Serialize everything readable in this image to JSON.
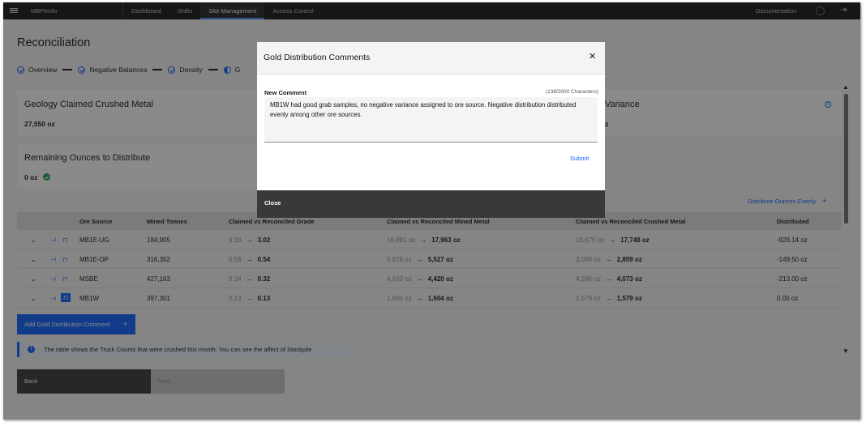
{
  "topbar": {
    "brand": "MBPitInfo",
    "nav": [
      "Dashboard",
      "Shifts",
      "Site Management",
      "Access Control"
    ],
    "active_nav": "Site Management",
    "documentation": "Documentation",
    "icons": [
      "menu-icon",
      "gear-icon",
      "logout-icon"
    ]
  },
  "page": {
    "title": "Reconciliation",
    "steps": [
      "Overview",
      "Negative Balances",
      "Density",
      "G"
    ]
  },
  "tiles": {
    "geology_label": "Geology Claimed Crushed Metal",
    "geology_value": "27,550 oz",
    "variance_label": "Variance",
    "variance_value": "z",
    "remaining_label": "Remaining Ounces to Distribute",
    "remaining_value": "0 oz"
  },
  "distribute_evenly": "Distribute Ounces Evenly",
  "table": {
    "headers": [
      "Ore Source",
      "Mined Tonnes",
      "Claimed vs Reconciled Grade",
      "Claimed vs Reconciled Mined Metal",
      "Claimed vs Reconciled Crushed Metal",
      "Distributed"
    ],
    "rows": [
      {
        "source": "MB1E-UG",
        "tonnes": "184,905",
        "grade_claimed": "3.18",
        "grade_rec": "3.02",
        "mined_claimed": "18,891 oz",
        "mined_rec": "17,963 oz",
        "crushed_claimed": "18,676 oz",
        "crushed_rec": "17,748 oz",
        "distributed": "-928.14 oz"
      },
      {
        "source": "MB1E-OP",
        "tonnes": "316,352",
        "grade_claimed": "0.56",
        "grade_rec": "0.54",
        "mined_claimed": "5,676 oz",
        "mined_rec": "5,527 oz",
        "crushed_claimed": "3,008 oz",
        "crushed_rec": "2,859 oz",
        "distributed": "-149.50 oz"
      },
      {
        "source": "MSBE",
        "tonnes": "427,163",
        "grade_claimed": "0.34",
        "grade_rec": "0.32",
        "mined_claimed": "4,633 oz",
        "mined_rec": "4,420 oz",
        "crushed_claimed": "4,286 oz",
        "crushed_rec": "4,073 oz",
        "distributed": "-213.00 oz"
      },
      {
        "source": "MB1W",
        "tonnes": "397,301",
        "grade_claimed": "0.13",
        "grade_rec": "0.13",
        "mined_claimed": "1,604 oz",
        "mined_rec": "1,604 oz",
        "crushed_claimed": "1,579 oz",
        "crushed_rec": "1,579 oz",
        "distributed": "0.00 oz"
      }
    ]
  },
  "add_comment": "Add Gold Distribution Comment",
  "notice": "The table shows the Truck Counts that were crushed this month. You can see the affect of Stockpile",
  "buttons": {
    "back": "Back",
    "next": "Next"
  },
  "modal": {
    "title": "Gold Distribution Comments",
    "comment_label": "New Comment",
    "char_count": "(138/2000 Characters)",
    "comment_text": "MB1W had good grab samples, no negative variance assigned to ore source. Negative distribution distributed evenly among other ore sources.",
    "submit": "Submit",
    "close": "Close"
  }
}
